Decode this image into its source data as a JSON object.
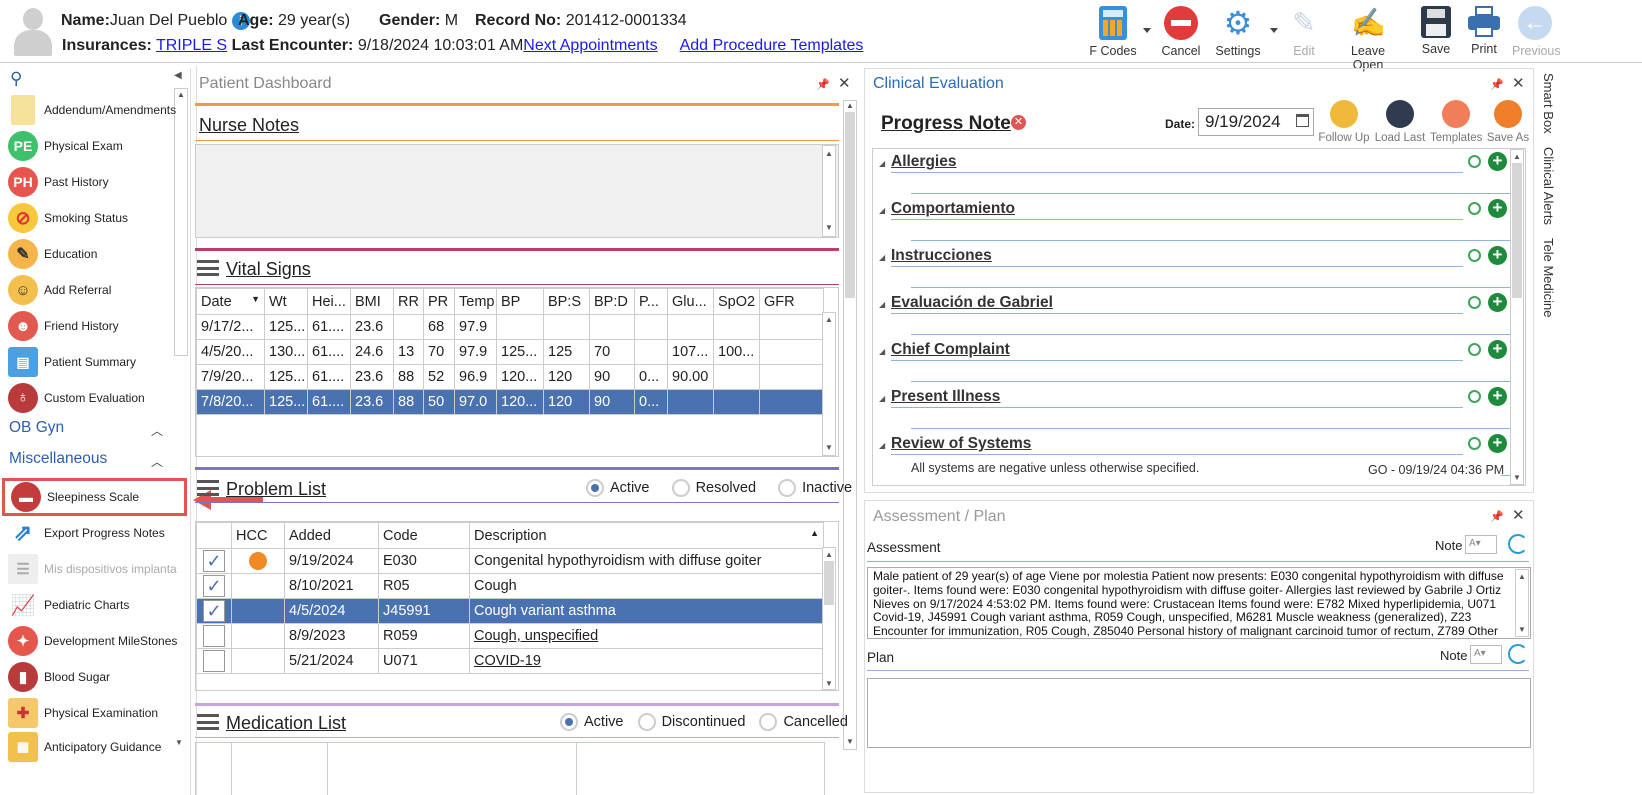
{
  "header": {
    "name_label": "Name:",
    "name_value": "Juan Del Pueblo",
    "age_label": "Age:",
    "age_value": "29 year(s)",
    "gender_label": "Gender:",
    "gender_value": "M",
    "record_label": "Record No:",
    "record_value": "201412-0001334",
    "insurances_label": "Insurances:",
    "insurances_value": "TRIPLE S",
    "last_encounter_label": "Last Encounter:",
    "last_encounter_value": "9/18/2024 10:03:01 AM",
    "next_appointments": "Next Appointments",
    "add_procedure_templates": "Add Procedure Templates"
  },
  "toolbar": {
    "fcodes": "F Codes",
    "cancel": "Cancel",
    "settings": "Settings",
    "edit": "Edit",
    "leave_open": "Leave Open",
    "save": "Save",
    "print": "Print",
    "previous": "Previous"
  },
  "sidebar": {
    "items": [
      {
        "label": "Addendum/Amendments",
        "icon": "document-icon"
      },
      {
        "label": "Physical Exam",
        "icon": "PE"
      },
      {
        "label": "Past History",
        "icon": "PH"
      },
      {
        "label": "Smoking Status",
        "icon": "no-smoking-icon"
      },
      {
        "label": "Education",
        "icon": "education-icon"
      },
      {
        "label": "Add Referral",
        "icon": "referral-icon"
      },
      {
        "label": "Friend History",
        "icon": "friends-icon"
      },
      {
        "label": "Patient Summary",
        "icon": "summary-icon"
      },
      {
        "label": "Custom Evaluation",
        "icon": "stethoscope-icon"
      }
    ],
    "section_obgyn": "OB Gyn",
    "section_misc": "Miscellaneous",
    "misc_items": [
      {
        "label": "Sleepiness Scale"
      },
      {
        "label": "Export Progress Notes"
      },
      {
        "label": "Mis dispositivos implanta"
      },
      {
        "label": "Pediatric Charts"
      },
      {
        "label": "Development MileStones"
      },
      {
        "label": "Blood Sugar"
      },
      {
        "label": "Physical Examination"
      },
      {
        "label": "Anticipatory Guidance"
      }
    ]
  },
  "dashboard": {
    "title": "Patient Dashboard",
    "nurse_notes": "Nurse Notes",
    "vital_signs": "Vital Signs",
    "vital_cols": [
      "Date",
      "Wt",
      "Hei...",
      "BMI",
      "RR",
      "PR",
      "Temp",
      "BP",
      "BP:S",
      "BP:D",
      "P...",
      "Glu...",
      "SpO2",
      "GFR"
    ],
    "vital_rows": [
      [
        "9/17/2...",
        "125...",
        "61....",
        "23.6",
        "",
        "68",
        "97.9",
        "",
        "",
        "",
        "",
        "",
        "",
        ""
      ],
      [
        "4/5/20...",
        "130...",
        "61....",
        "24.6",
        "13",
        "70",
        "97.9",
        "125...",
        "125",
        "70",
        "",
        "107...",
        "100...",
        ""
      ],
      [
        "7/9/20...",
        "125...",
        "61....",
        "23.6",
        "88",
        "52",
        "96.9",
        "120...",
        "120",
        "90",
        "0...",
        "90.00",
        "",
        ""
      ],
      [
        "7/8/20...",
        "125...",
        "61....",
        "23.6",
        "88",
        "50",
        "97.0",
        "120...",
        "120",
        "90",
        "0...",
        "",
        "",
        ""
      ]
    ],
    "problem_list": "Problem List",
    "problem_filters": [
      "Active",
      "Resolved",
      "Inactive"
    ],
    "problem_cols": [
      "HCC",
      "Added",
      "Code",
      "Description"
    ],
    "problem_rows": [
      {
        "added": "9/19/2024",
        "code": "E030",
        "desc": "Congenital hypothyroidism with diffuse goiter"
      },
      {
        "added": "8/10/2021",
        "code": "R05",
        "desc": "Cough"
      },
      {
        "added": "4/5/2024",
        "code": "J45991",
        "desc": "Cough variant asthma"
      },
      {
        "added": "8/9/2023",
        "code": "R059",
        "desc": "Cough, unspecified"
      },
      {
        "added": "5/21/2024",
        "code": "U071",
        "desc": "COVID-19"
      }
    ],
    "medication_list": "Medication List",
    "med_filters": [
      "Active",
      "Discontinued",
      "Cancelled"
    ]
  },
  "clinical": {
    "title": "Clinical Evaluation",
    "progress_note": "Progress Note",
    "date_label": "Date:",
    "date_value": "9/19/2024",
    "buttons": [
      "Follow Up",
      "Load Last",
      "Templates",
      "Save As"
    ],
    "sections": [
      "Allergies",
      "Comportamiento",
      "Instrucciones",
      "Evaluación de Gabriel",
      "Chief Complaint",
      "Present Illness",
      "Review of Systems"
    ],
    "ros_text": "All systems are negative unless otherwise specified.",
    "ros_stamp": "GO - 09/19/24 04:36 PM"
  },
  "assessment": {
    "title": "Assessment / Plan",
    "assessment_label": "Assessment",
    "note_label": "Note",
    "assessment_text": "Male patient of 29 year(s) of age Viene por molestia Patient now presents: E030 congenital hypothyroidism with diffuse goiter-. Items found were: E030 congenital hypothyroidism with diffuse goiter-   Allergies last reviewed by Gabrile J Ortiz Nieves on 9/17/2024 4:53:02 PM.    Items found were:  Crustacean  Items found were:  E782 Mixed hyperlipidemia, U071 Covid-19, J45991 Cough variant asthma, R059 Cough, unspecified, M6281 Muscle weakness (generalized), Z23 Encounter for immunization, R05 Cough, Z85040 Personal history of malignant carcinoid tumor of rectum, Z789 Other",
    "plan_label": "Plan"
  },
  "right_tabs": [
    "Smart Box",
    "Clinical Alerts",
    "Tele Medicine"
  ],
  "colors": {
    "accent": "#4a72b0",
    "orange": "#f39a3d",
    "red": "#d94545",
    "purple": "#7b74c9",
    "maroon": "#b83f6a",
    "green": "#1e8a3c"
  }
}
